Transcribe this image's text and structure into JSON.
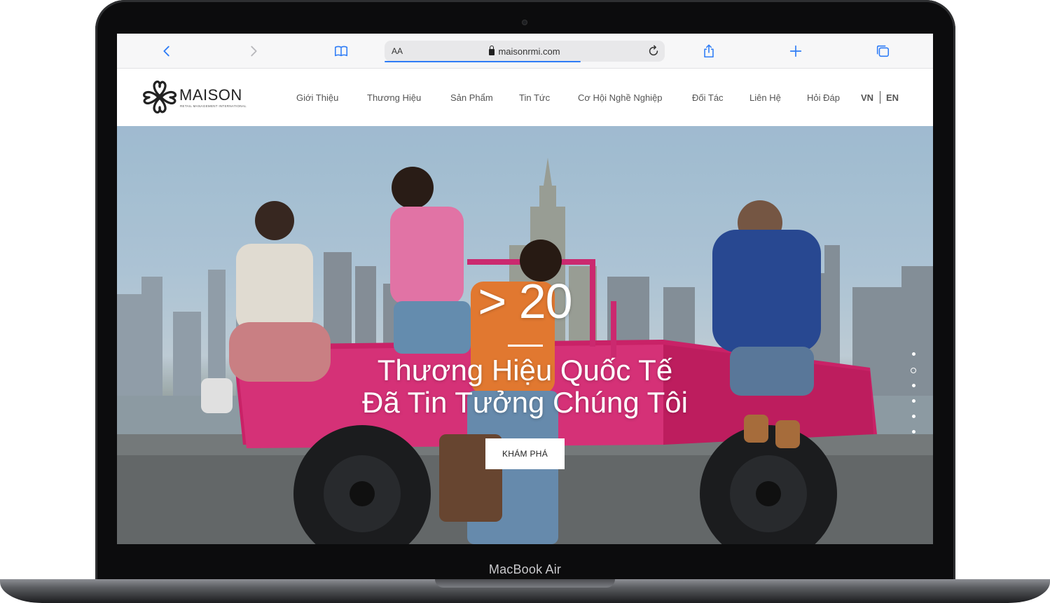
{
  "device": {
    "label": "MacBook Air"
  },
  "browser": {
    "text_size_label": "AA",
    "url": "maisonrmi.com",
    "page_load_progress": 0.7,
    "accent_color": "#2e7cf6",
    "icons": [
      "back-icon",
      "forward-icon",
      "bookmarks-icon",
      "lock-icon",
      "reload-icon",
      "share-icon",
      "new-tab-icon",
      "tabs-icon"
    ]
  },
  "site": {
    "logo": {
      "name": "MAISON",
      "tagline": "RETAIL MANAGEMENT INTERNATIONAL"
    },
    "nav": [
      {
        "label": "Giới Thiệu"
      },
      {
        "label": "Thương Hiệu"
      },
      {
        "label": "Sản Phẩm"
      },
      {
        "label": "Tin Tức"
      },
      {
        "label": "Cơ Hội Nghề Nghiệp"
      },
      {
        "label": "Đối Tác"
      },
      {
        "label": "Liên Hệ"
      },
      {
        "label": "Hỏi Đáp"
      }
    ],
    "languages": {
      "vn": "VN",
      "en": "EN"
    }
  },
  "hero": {
    "stat": "> 20",
    "line1": "Thương Hiệu Quốc Tế",
    "line2": "Đã Tin Tưởng Chúng Tôi",
    "cta": "KHÁM PHÁ",
    "slides": {
      "total": 6,
      "active": 1
    }
  }
}
